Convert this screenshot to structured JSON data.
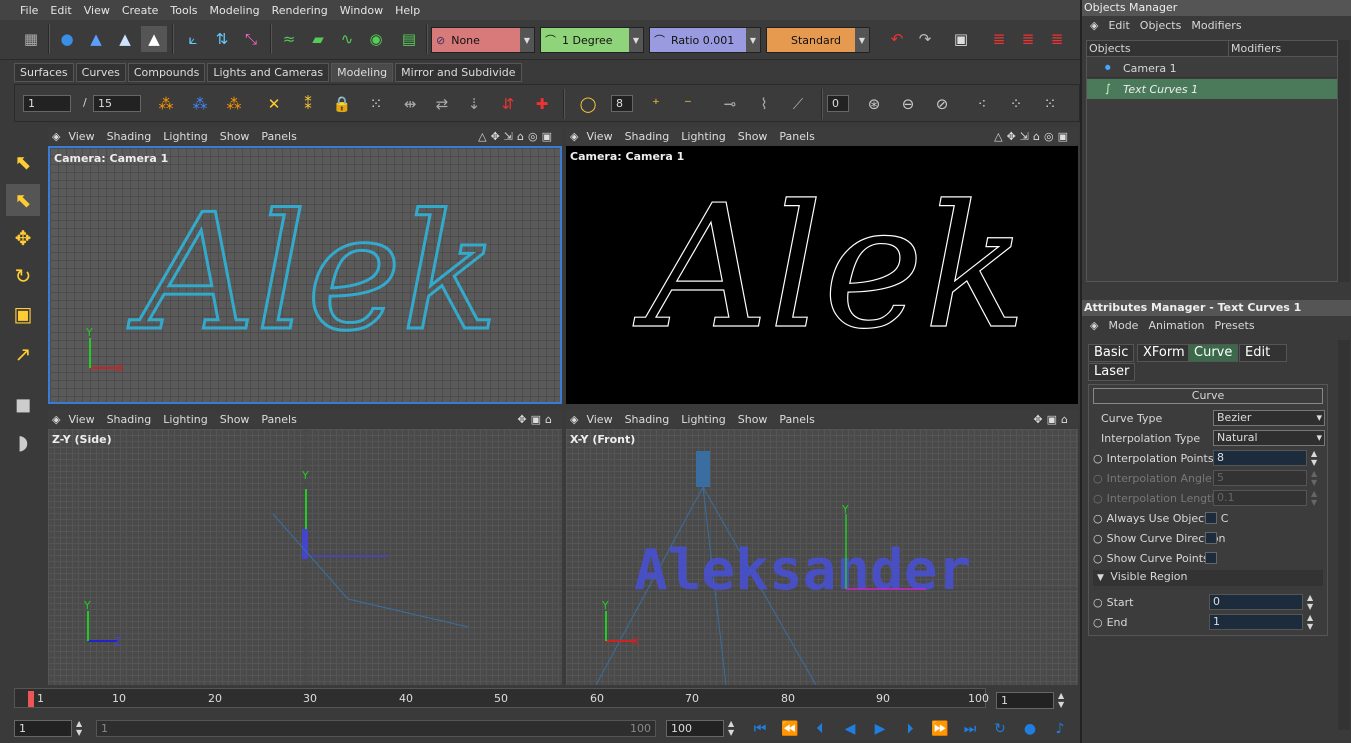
{
  "menu": [
    "File",
    "Edit",
    "View",
    "Create",
    "Tools",
    "Modeling",
    "Rendering",
    "Window",
    "Help"
  ],
  "toolbar": {
    "interp_none": "None",
    "degree": "1 Degree",
    "ratio": "Ratio 0.001",
    "render_mode": "Standard",
    "colors": {
      "none_bg": "#d97a7a",
      "degree_bg": "#8fd47a",
      "ratio_bg": "#9a9ae0",
      "standard_bg": "#e69a50"
    }
  },
  "tabs": [
    "Surfaces",
    "Curves",
    "Compounds",
    "Lights and Cameras",
    "Modeling",
    "Mirror and Subdivide"
  ],
  "active_tab": "Modeling",
  "frame": {
    "current": "1",
    "total": "15",
    "segments": "8",
    "offset": "0"
  },
  "viewport_menu": [
    "View",
    "Shading",
    "Lighting",
    "Show",
    "Panels"
  ],
  "viewports": {
    "top_left": "Camera: Camera 1",
    "top_right": "Camera: Camera 1",
    "bottom_left": "Z-Y (Side)",
    "bottom_right": "X-Y (Front)"
  },
  "text_preview": "Alek",
  "front_text": "Aleksander",
  "axis_labels": {
    "x": "X",
    "y": "Y",
    "z": "Z"
  },
  "objects_manager": {
    "title": "Objects Manager",
    "menu": [
      "Edit",
      "Objects",
      "Modifiers"
    ],
    "col_objects": "Objects",
    "col_modifiers": "Modifiers",
    "items": [
      {
        "name": "Camera 1",
        "icon": "camera-icon"
      },
      {
        "name": "Text Curves 1",
        "icon": "curve-icon"
      }
    ]
  },
  "attributes_manager": {
    "title": "Attributes Manager - Text Curves 1",
    "menu": [
      "Mode",
      "Animation",
      "Presets"
    ],
    "tabs": [
      "Basic",
      "XForm",
      "Curve",
      "Edit",
      "Laser"
    ],
    "active_tab": "Curve",
    "section": "Curve",
    "curve_type_label": "Curve Type",
    "curve_type": "Bezier",
    "interp_type_label": "Interpolation Type",
    "interp_type": "Natural",
    "interp_points_label": "Interpolation Points",
    "interp_points": "8",
    "interp_angle_label": "Interpolation Angle",
    "interp_angle": "5",
    "interp_length_label": "Interpolation Length",
    "interp_length": "0.1",
    "always_use_label": "Always Use Object's C",
    "show_dir_label": "Show Curve Direction",
    "show_points_label": "Show Curve Points",
    "visible_region_label": "Visible Region",
    "start_label": "Start",
    "start": "0",
    "end_label": "End",
    "end": "1"
  },
  "timeline": {
    "ticks": [
      "1",
      "10",
      "20",
      "30",
      "40",
      "50",
      "60",
      "70",
      "80",
      "90",
      "100"
    ],
    "current_frame": "1",
    "start": "1",
    "range_start": "1",
    "range_end": "100",
    "end": "100"
  }
}
